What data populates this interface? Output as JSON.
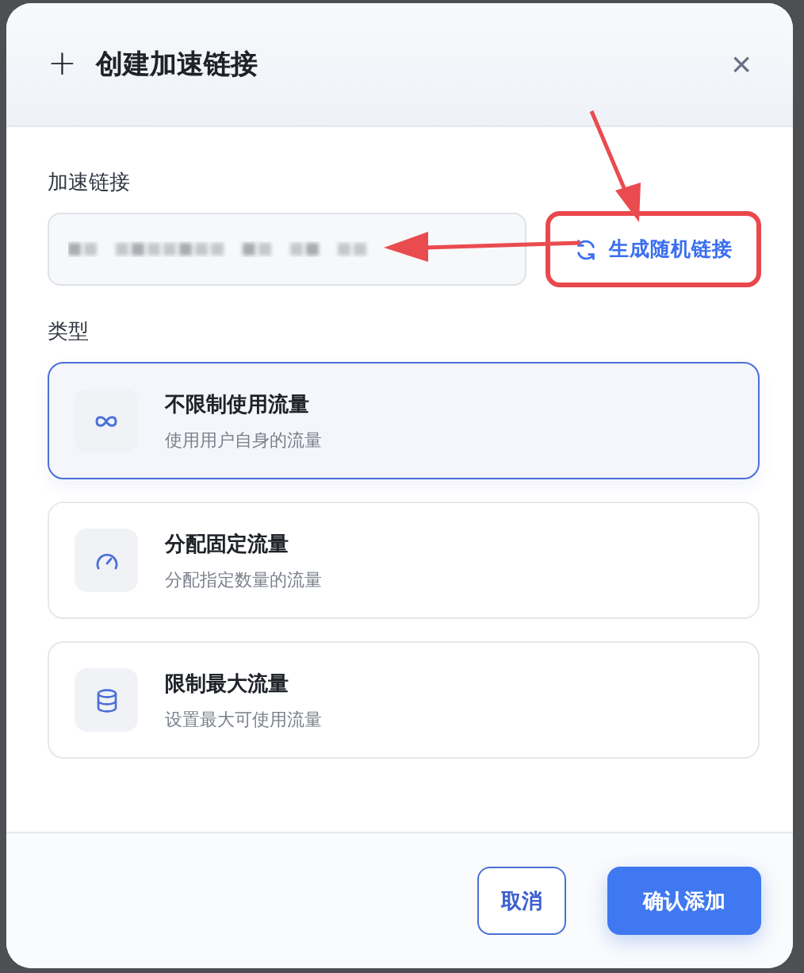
{
  "dialog": {
    "title": "创建加速链接",
    "title_icon": "+",
    "close": "×"
  },
  "link_field": {
    "label": "加速链接",
    "redacted": true
  },
  "generate_button": {
    "label": "生成随机链接",
    "highlighted": true
  },
  "type_section": {
    "label": "类型",
    "options": [
      {
        "kind": "infinity",
        "title": "不限制使用流量",
        "description": "使用用户自身的流量",
        "selected": true
      },
      {
        "kind": "gauge",
        "title": "分配固定流量",
        "description": "分配指定数量的流量",
        "selected": false
      },
      {
        "kind": "database",
        "title": "限制最大流量",
        "description": "设置最大可使用流量",
        "selected": false
      }
    ]
  },
  "buttons": {
    "cancel": "取消",
    "confirm": "确认添加"
  }
}
